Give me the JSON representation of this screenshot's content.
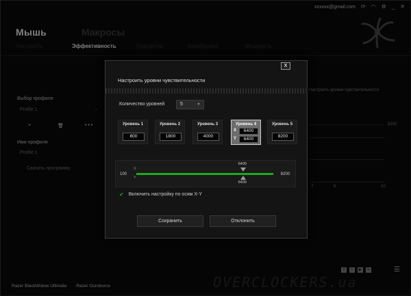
{
  "topbar": {
    "email": "xxxxxx@gmail.com",
    "icons": [
      "refresh-icon",
      "wifi-icon",
      "gear-icon"
    ],
    "controls": [
      "minimize",
      "close"
    ],
    "minimize_glyph": "_",
    "close_glyph": "✕"
  },
  "app": {
    "title": "Мышь",
    "macros": "Макросы"
  },
  "tabs": [
    {
      "label": "Настроить",
      "active": false
    },
    {
      "label": "Эффективность",
      "active": true
    },
    {
      "label": "Подсветка",
      "active": false
    },
    {
      "label": "Калибровка",
      "active": false
    },
    {
      "label": "Мощность",
      "active": false
    }
  ],
  "left": {
    "profile_select_title": "Выбор профиля",
    "profile_value": "Profile 1",
    "profile_arrow": "›",
    "profile_add": "+",
    "profile_delete": "🗑",
    "profile_more": "• • •",
    "profile_name_title": "Имя профиля",
    "profile_name_value": "Profile 1",
    "link_program": "Связать программу"
  },
  "right_bg": {
    "sensitivity_label": "Настроить уровни чувствительности",
    "max_value": "8200",
    "scale": [
      "7",
      "8",
      "10"
    ]
  },
  "modal": {
    "close_label": "X",
    "title": "Настроить уровни чувствительности",
    "levels_count_label": "Количество уровней",
    "levels_count_value": "5",
    "levels_count_arrow": "▼",
    "levels": [
      {
        "label": "Уровень 1",
        "value": "800"
      },
      {
        "label": "Уровень 2",
        "value": "1800"
      },
      {
        "label": "Уровень 3",
        "value": "4000"
      },
      {
        "label": "Уровень 4",
        "x_label": "X",
        "y_label": "Y",
        "x_value": "6400",
        "y_value": "6400"
      },
      {
        "label": "Уровень 5",
        "value": "8200"
      }
    ],
    "slider": {
      "min": "100",
      "max": "8200",
      "x_axis": "X",
      "y_axis": "Y",
      "x_value": "6400",
      "y_value": "6400",
      "x_fraction": 0.778,
      "y_fraction": 0.778
    },
    "checkbox_label": "Включить настройку по осям X-Y",
    "checkbox_checked": true,
    "checkbox_glyph": "✔",
    "save_label": "Сохранить",
    "cancel_label": "Отклонить"
  },
  "bottom": {
    "devices": [
      "Razer BlackWidow Ultimate",
      "Razer Ouroboros"
    ],
    "watermark": "OVERCLOCKERS.ua",
    "social_icons": [
      "facebook-icon",
      "twitter-icon",
      "youtube-icon",
      "feedback-icon"
    ],
    "social_glyphs": [
      "f",
      "t",
      "▶",
      "✎"
    ],
    "menu_glyph": "☰"
  },
  "colors": {
    "accent_green": "#1fa81f",
    "background": "#0a0a0a",
    "modal_bg": "#141414"
  }
}
